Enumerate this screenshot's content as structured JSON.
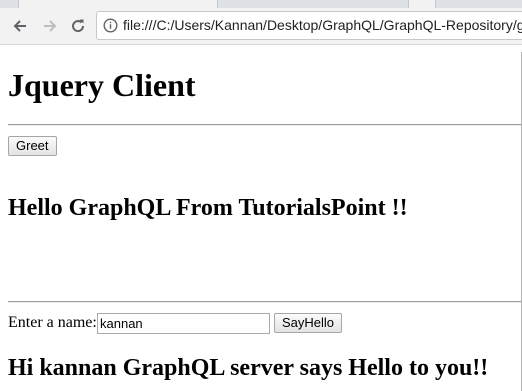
{
  "browser": {
    "url": "file:///C:/Users/Kannan/Desktop/GraphQL/GraphQL-Repository/g",
    "icons": {
      "back": "arrow-left-icon",
      "forward": "arrow-right-icon",
      "reload": "reload-icon",
      "info": "info-icon"
    }
  },
  "page": {
    "title": "Jquery Client",
    "greet_button": "Greet",
    "greet_message": "Hello GraphQL From TutorialsPoint !!",
    "name_label": "Enter a name:",
    "name_value": "kannan",
    "sayhello_button": "SayHello",
    "hello_message": "Hi kannan GraphQL server says Hello to you!!"
  }
}
